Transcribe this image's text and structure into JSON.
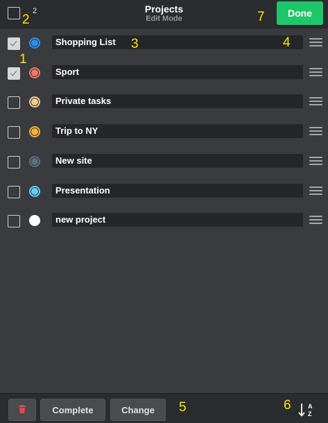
{
  "header": {
    "title": "Projects",
    "subtitle": "Edit Mode",
    "selected_count": "2",
    "done_label": "Done"
  },
  "projects": [
    {
      "name": "Shopping List",
      "checked": true,
      "color": "#2a8ff0"
    },
    {
      "name": "Sport",
      "checked": true,
      "color": "#f07a6a"
    },
    {
      "name": "Private tasks",
      "checked": false,
      "color": "#f2c98f"
    },
    {
      "name": "Trip to NY",
      "checked": false,
      "color": "#f5b23a"
    },
    {
      "name": "New site",
      "checked": false,
      "color": "#5b6f7e"
    },
    {
      "name": "Presentation",
      "checked": false,
      "color": "#5fd0f5"
    },
    {
      "name": "new project",
      "checked": false,
      "color": "#ffffff"
    }
  ],
  "footer": {
    "complete_label": "Complete",
    "change_label": "Change",
    "trash_icon": "trash-icon",
    "sort_icon": "sort-az-icon"
  },
  "annotations": [
    "1",
    "2",
    "3",
    "4",
    "5",
    "6",
    "7"
  ],
  "colors": {
    "background": "#3a3b3f",
    "done": "#1ec66a",
    "trash": "#e5484d",
    "annotation": "#ffe600"
  }
}
